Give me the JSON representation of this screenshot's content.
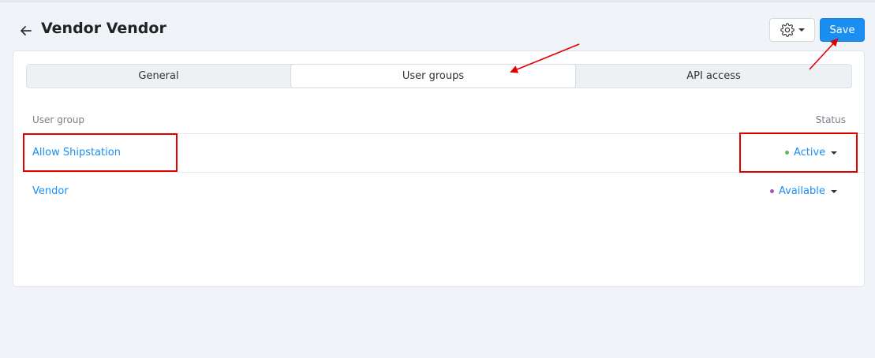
{
  "header": {
    "title": "Vendor Vendor",
    "save_label": "Save"
  },
  "tabs": [
    {
      "label": "General",
      "active": false
    },
    {
      "label": "User groups",
      "active": true
    },
    {
      "label": "API access",
      "active": false
    }
  ],
  "table": {
    "columns": {
      "group": "User group",
      "status": "Status"
    },
    "rows": [
      {
        "name": "Allow Shipstation",
        "status": "Active",
        "dot_color": "#5cb85c"
      },
      {
        "name": "Vendor",
        "status": "Available",
        "dot_color": "#9b59b6"
      }
    ]
  },
  "icons": {
    "back": "arrow-left-icon",
    "settings": "gear-icon",
    "dropdown": "caret-down-icon"
  },
  "colors": {
    "accent": "#1b8ef2",
    "annotation": "#e00000"
  }
}
